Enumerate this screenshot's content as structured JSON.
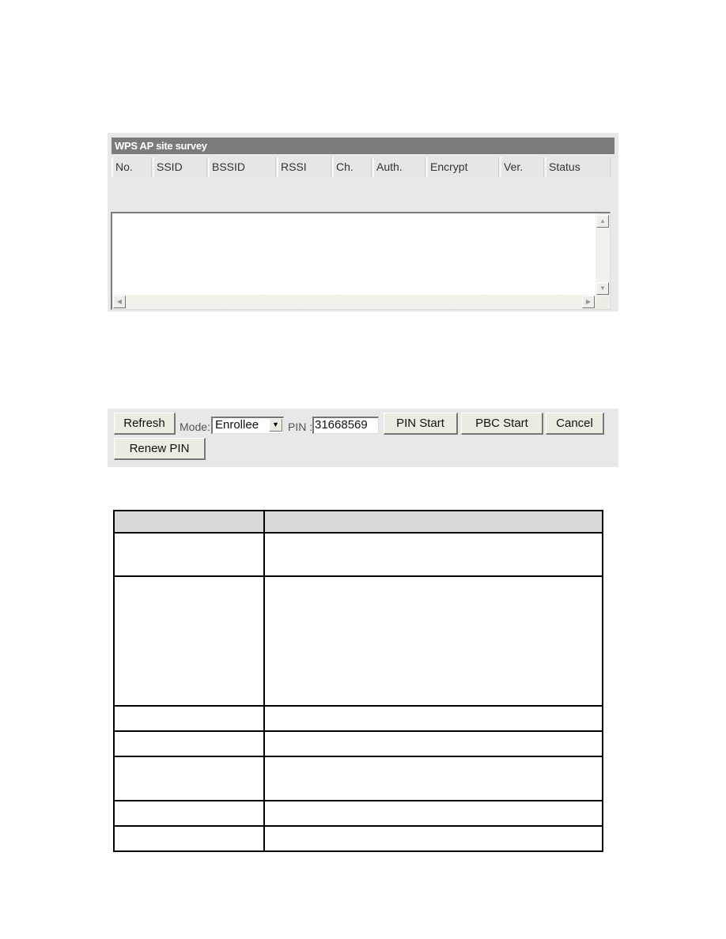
{
  "survey": {
    "title": "WPS AP site survey",
    "columns": [
      "No.",
      "SSID",
      "BSSID",
      "RSSI",
      "Ch.",
      "Auth.",
      "Encrypt",
      "Ver.",
      "Status"
    ],
    "rows": [],
    "scroll_icons": {
      "up": "▲",
      "down": "▼",
      "left": "◀",
      "right": "▶"
    }
  },
  "controls": {
    "refresh_label": "Refresh",
    "mode_label": "Mode:",
    "mode_value": "Enrollee",
    "mode_arrow": "▼",
    "pin_label": "PIN :",
    "pin_value": "31668569",
    "pin_start_label": "PIN Start",
    "pbc_start_label": "PBC Start",
    "cancel_label": "Cancel",
    "renew_pin_label": "Renew PIN"
  },
  "description_table": {
    "header": [
      "",
      ""
    ],
    "rows": [
      [
        "",
        ""
      ],
      [
        "",
        ""
      ],
      [
        "",
        ""
      ],
      [
        "",
        ""
      ],
      [
        "",
        ""
      ],
      [
        "",
        ""
      ],
      [
        "",
        ""
      ]
    ]
  }
}
